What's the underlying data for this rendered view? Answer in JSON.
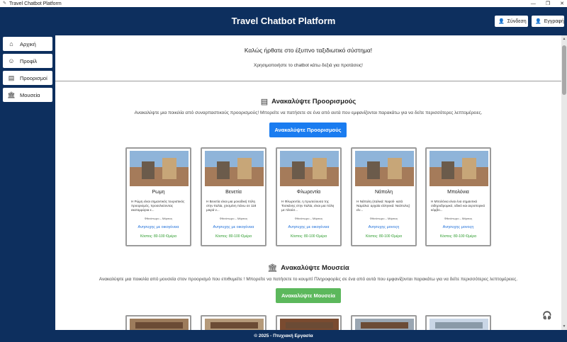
{
  "window": {
    "title": "Travel Chatbot Platform",
    "controls": [
      "—",
      "❐",
      "✕"
    ]
  },
  "header": {
    "title": "Travel Chatbot Platform",
    "login_label": "Σύνδεση",
    "register_label": "Εγγραφή"
  },
  "sidebar": {
    "items": [
      {
        "label": "Αρχική",
        "icon": "home-icon"
      },
      {
        "label": "Προφίλ",
        "icon": "user-icon"
      },
      {
        "label": "Προορισμοί",
        "icon": "clipboard-icon"
      },
      {
        "label": "Μουσεία",
        "icon": "museum-icon"
      }
    ]
  },
  "main": {
    "welcome": "Καλώς ήρθατε στο έξυπνο ταξιδιωτικό σύστημα!",
    "welcome_sub": "Χρησιμοποιήστε το chatbot κάτω δεξιά για προτάσεις!",
    "destinations": {
      "title": "Ανακαλύψτε Προορισμούς",
      "description": "Ανακαλύψτε μια ποικιλία από συναρπαστικούς προορισμούς! Μπορείτε να πατήσετε σε ένα από αυτά που εμφανίζονται παρακάτω για να δείτε περισσότερες λεπτομέρειες.",
      "button": "Ανακαλύψτε Προορισμούς",
      "button_color": "#1a7cf0",
      "cards": [
        {
          "name": "Ρωμη",
          "desc": "Η Ρώμη είναι σημαντικός τουριστικός προορισμός, προσελκύοντας εκατομμύρια ε...",
          "season": "Φθινόπωρο – Μάρτιος",
          "tag": "Ανησυχης με οικογένεια",
          "cost": "Κόστος: 80-100 €/μέρα"
        },
        {
          "name": "Βενετία",
          "desc": "Η Βενετία είναι μια μοναδική πόλη στην Ιταλία, χτισμένη πάνω σε 118 μικρά ν...",
          "season": "Φθινόπωρο – Μάρτιος",
          "tag": "Ανησυχης με οικογένεια",
          "cost": "Κόστος: 80-100 €/μέρα"
        },
        {
          "name": "Φλωρεντία",
          "desc": "Η Φλωρεντία, η πρωτεύουσα της Τοσκάνης στην Ιταλία, είναι μια πόλη με πλούσ...",
          "season": "Φθινόπωρο – Μάρτιος",
          "tag": "Ανησυχης με οικογένεια",
          "cost": "Κόστος: 80-100 €/μέρα"
        },
        {
          "name": "Νάπολη",
          "desc": "Η Νάπολη (ιταλικά: Napoli· κατά Ναμύλια: αρχαία ελληνικά: Νεάπολις) είν...",
          "season": "Φθινόπωρο – Μάρτιος",
          "tag": "Ανησυχης μονοςη",
          "cost": "Κόστος: 80-100 €/μέρα"
        },
        {
          "name": "Μπολόνια",
          "desc": "Η Μπολόνια είναι ένα σημαντικό σιδηροδρομικό, οδικό και αεροπορικό κόμβο...",
          "season": "Φθινόπωρο – Μάρτιος",
          "tag": "Ανησυχης μονοςη",
          "cost": "Κόστος: 80-100 €/μέρα"
        }
      ]
    },
    "museums": {
      "title": "Ανακαλύψτε Μουσεία",
      "description": "Ανακαλύψτε μια ποικιλία από μουσεία στον προορισμό που επιθυμείτε ! Μπορείτε να πατήσετε το κουμπί Πληροφορίες σε ένα από αυτά που εμφανίζονται παρακάτω για να δείτε περισσότερες λεπτομέρειες.",
      "button": "Ανακαλύψτε Μουσεία",
      "button_color": "#5cb85c"
    }
  },
  "footer": {
    "text": "© 2025 - Πτυχιακή Εργασία"
  },
  "chatbot": {
    "icon": "chatbot-icon"
  }
}
